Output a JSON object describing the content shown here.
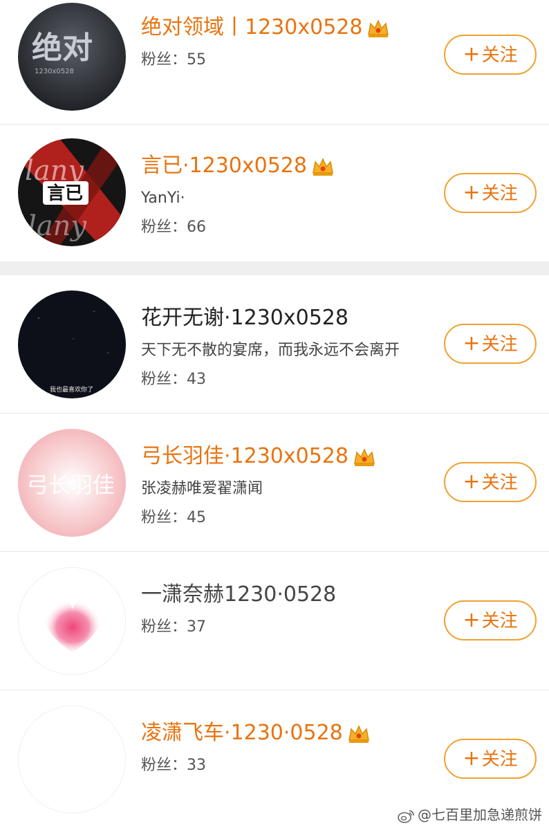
{
  "colors": {
    "vip_name": "#e8730f",
    "button_border": "#f0a030",
    "divider": "#e6e6e6",
    "section_gap": "#efefef"
  },
  "follow_label": "关注",
  "users": [
    {
      "name": "绝对领域丨1230x0528",
      "vip": true,
      "bio": "",
      "fans_label": "粉丝：",
      "fans_count": "55",
      "avatar_text": "绝对",
      "avatar_sub": "1230x0528"
    },
    {
      "name": "言已·1230x0528",
      "vip": true,
      "bio": "YanYi·",
      "fans_label": "粉丝：",
      "fans_count": "66",
      "avatar_text": "言已"
    },
    {
      "name": "花开无谢·1230x0528",
      "vip": false,
      "bio": "天下无不散的宴席，而我永远不会离开",
      "fans_label": "粉丝：",
      "fans_count": "43",
      "avatar_text": "我也最喜欢你了"
    },
    {
      "name": "弓长羽佳·1230x0528",
      "vip": true,
      "bio": "张凌赫唯爱翟潇闻",
      "fans_label": "粉丝：",
      "fans_count": "45",
      "avatar_text": "弓长羽佳"
    },
    {
      "name": "一潇奈赫1230·0528",
      "vip": false,
      "bio": "",
      "fans_label": "粉丝：",
      "fans_count": "37"
    },
    {
      "name": "凌潇飞车·1230·0528",
      "vip": true,
      "bio": "",
      "fans_label": "粉丝：",
      "fans_count": "33"
    }
  ],
  "watermark": "@七百里加急递煎饼",
  "icons": {
    "crown": "crown-icon",
    "plus": "plus-icon",
    "weibo": "weibo-logo-icon"
  }
}
